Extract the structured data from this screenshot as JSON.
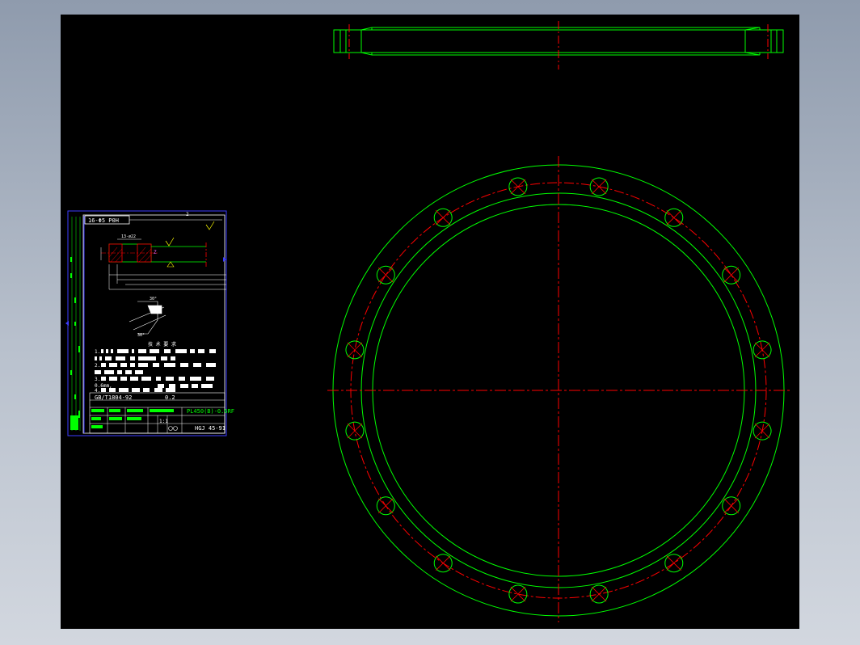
{
  "colors": {
    "background": "#000000",
    "outline": "#00ff00",
    "centerline": "#ff0000",
    "frame": "#3c3cff",
    "text_white": "#ffffff",
    "text_yellow": "#ffff00",
    "text_green": "#00ff00"
  },
  "flange_plan": {
    "bolt_hole_count": 16
  },
  "title_sheet": {
    "hole_note": "16-Φ5 P0H",
    "sheet_mark": "2",
    "requirements_title": "技 术 要 求",
    "requirement_lines": [
      "1.",
      "2.",
      "3.",
      "4."
    ],
    "tolerance_fragment": "0.6mm,",
    "standard_ref": "GB/T1804-92",
    "tolerance_value": "0.2",
    "part_name": "PL450(B)-0.6RF",
    "drawing_number": "HGJ 45-91",
    "scale": "1:1"
  }
}
